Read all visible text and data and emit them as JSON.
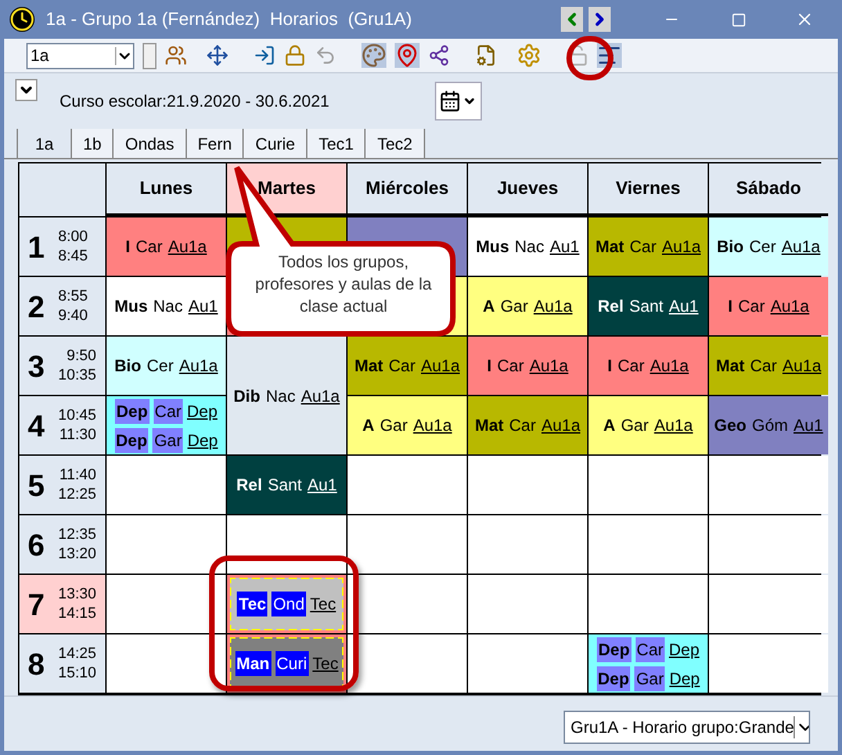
{
  "window": {
    "title": "1a - Grupo 1a (Fernández)  Horarios  (Gru1A)"
  },
  "toolbar": {
    "class_select": {
      "value": "1a"
    }
  },
  "info": {
    "school_year": "Curso escolar:21.9.2020 - 30.6.2021"
  },
  "tabs": [
    {
      "label": "1a",
      "selected": true
    },
    {
      "label": "1b",
      "selected": false
    },
    {
      "label": "Ondas",
      "selected": false
    },
    {
      "label": "Fern",
      "selected": false
    },
    {
      "label": "Curie",
      "selected": false
    },
    {
      "label": "Tec1",
      "selected": false
    },
    {
      "label": "Tec2",
      "selected": false
    }
  ],
  "days": [
    {
      "label": "Lunes",
      "selected": false
    },
    {
      "label": "Martes",
      "selected": true
    },
    {
      "label": "Miércoles",
      "selected": false
    },
    {
      "label": "Jueves",
      "selected": false
    },
    {
      "label": "Viernes",
      "selected": false
    },
    {
      "label": "Sábado",
      "selected": false
    }
  ],
  "periods": [
    {
      "number": "1",
      "start": "8:00",
      "end": "8:45",
      "selected": false,
      "cells": [
        {
          "kind": "lesson",
          "color": "#ff8080",
          "lessons": [
            {
              "kind": "plain",
              "subject": "I",
              "teacher": "Car",
              "room": "Au1a"
            }
          ]
        },
        {
          "kind": "lesson",
          "color": "#b8b800"
        },
        {
          "kind": "lesson",
          "color": "#8080c0"
        },
        {
          "kind": "lesson",
          "color": "#ffffff",
          "lessons": [
            {
              "kind": "plain",
              "subject": "Mus",
              "teacher": "Nac",
              "room": "Au1"
            }
          ]
        },
        {
          "kind": "lesson",
          "color": "#b8b800",
          "lessons": [
            {
              "kind": "plain",
              "subject": "Mat",
              "teacher": "Car",
              "room": "Au1a"
            }
          ]
        },
        {
          "kind": "lesson",
          "color": "#d0ffff",
          "lessons": [
            {
              "kind": "plain",
              "subject": "Bio",
              "teacher": "Cer",
              "room": "Au1a"
            }
          ]
        }
      ]
    },
    {
      "number": "2",
      "start": "8:55",
      "end": "9:40",
      "selected": false,
      "cells": [
        {
          "kind": "lesson",
          "color": "#ffffff",
          "lessons": [
            {
              "kind": "plain",
              "subject": "Mus",
              "teacher": "Nac",
              "room": "Au1"
            }
          ]
        },
        {
          "kind": "lesson",
          "color": "#ff8080"
        },
        {
          "kind": "lesson",
          "color": "#ffff80"
        },
        {
          "kind": "lesson",
          "color": "#ffff80",
          "lessons": [
            {
              "kind": "plain",
              "subject": "A",
              "teacher": "Gar",
              "room": "Au1a"
            }
          ]
        },
        {
          "kind": "lesson",
          "color": "#004040",
          "lessons": [
            {
              "kind": "plain",
              "subject": "Rel",
              "teacher": "Sant",
              "room": "Au1"
            }
          ]
        },
        {
          "kind": "lesson",
          "color": "#ff8080",
          "lessons": [
            {
              "kind": "plain",
              "subject": "I",
              "teacher": "Car",
              "room": "Au1a"
            }
          ]
        }
      ]
    },
    {
      "number": "3",
      "start": "9:50",
      "end": "10:35",
      "selected": false,
      "cells": [
        {
          "kind": "lesson",
          "color": "#d0ffff",
          "lessons": [
            {
              "kind": "plain",
              "subject": "Bio",
              "teacher": "Cer",
              "room": "Au1a"
            }
          ]
        },
        {
          "kind": "lesson",
          "color": "#e0e8f0",
          "lessons": [
            {
              "kind": "plain",
              "subject": "Dib",
              "teacher": "Nac",
              "room": "Au1a"
            }
          ]
        },
        {
          "kind": "lesson",
          "color": "#b8b800",
          "lessons": [
            {
              "kind": "plain",
              "subject": "Mat",
              "teacher": "Car",
              "room": "Au1a"
            }
          ]
        },
        {
          "kind": "lesson",
          "color": "#ff8080",
          "lessons": [
            {
              "kind": "plain",
              "subject": "I",
              "teacher": "Car",
              "room": "Au1a"
            }
          ]
        },
        {
          "kind": "lesson",
          "color": "#ff8080",
          "lessons": [
            {
              "kind": "plain",
              "subject": "I",
              "teacher": "Car",
              "room": "Au1a"
            }
          ]
        },
        {
          "kind": "lesson",
          "color": "#b8b800",
          "lessons": [
            {
              "kind": "plain",
              "subject": "Mat",
              "teacher": "Car",
              "room": "Au1a"
            }
          ]
        }
      ]
    },
    {
      "number": "4",
      "start": "10:45",
      "end": "11:30",
      "selected": false,
      "cells": [
        {
          "kind": "lesson",
          "color": "#80ffff",
          "lessons": [
            {
              "kind": "split",
              "subject": "Dep",
              "teacher": "Car",
              "room": "Dep"
            },
            {
              "kind": "split",
              "subject": "Dep",
              "teacher": "Gar",
              "room": "Dep"
            }
          ]
        },
        {
          "kind": "continued"
        },
        {
          "kind": "lesson",
          "color": "#ffff80",
          "lessons": [
            {
              "kind": "plain",
              "subject": "A",
              "teacher": "Gar",
              "room": "Au1a"
            }
          ]
        },
        {
          "kind": "lesson",
          "color": "#b8b800",
          "lessons": [
            {
              "kind": "plain",
              "subject": "Mat",
              "teacher": "Car",
              "room": "Au1a"
            }
          ]
        },
        {
          "kind": "lesson",
          "color": "#ffff80",
          "lessons": [
            {
              "kind": "plain",
              "subject": "A",
              "teacher": "Gar",
              "room": "Au1a"
            }
          ]
        },
        {
          "kind": "lesson",
          "color": "#8080c0",
          "lessons": [
            {
              "kind": "plain",
              "subject": "Geo",
              "teacher": "Góm",
              "room": "Au1"
            }
          ]
        }
      ]
    },
    {
      "number": "5",
      "start": "11:40",
      "end": "12:25",
      "selected": false,
      "cells": [
        {
          "kind": "empty"
        },
        {
          "kind": "lesson",
          "color": "#004040",
          "lessons": [
            {
              "kind": "plain",
              "subject": "Rel",
              "teacher": "Sant",
              "room": "Au1"
            }
          ]
        },
        {
          "kind": "empty"
        },
        {
          "kind": "empty"
        },
        {
          "kind": "empty"
        },
        {
          "kind": "empty"
        }
      ]
    },
    {
      "number": "6",
      "start": "12:35",
      "end": "13:20",
      "selected": false,
      "cells": [
        {
          "kind": "empty"
        },
        {
          "kind": "empty"
        },
        {
          "kind": "empty"
        },
        {
          "kind": "empty"
        },
        {
          "kind": "empty"
        },
        {
          "kind": "empty"
        }
      ]
    },
    {
      "number": "7",
      "start": "13:30",
      "end": "14:15",
      "selected": true,
      "cells": [
        {
          "kind": "empty"
        },
        {
          "kind": "lesson",
          "color": "#c0c0c0",
          "lessons": [
            {
              "kind": "marked",
              "subject": "Tec",
              "teacher": "Ond",
              "room": "Tec"
            }
          ]
        },
        {
          "kind": "empty"
        },
        {
          "kind": "empty"
        },
        {
          "kind": "empty"
        },
        {
          "kind": "empty"
        }
      ]
    },
    {
      "number": "8",
      "start": "14:25",
      "end": "15:10",
      "selected": false,
      "cells": [
        {
          "kind": "empty"
        },
        {
          "kind": "lesson",
          "color": "#808080",
          "lessons": [
            {
              "kind": "marked",
              "subject": "Man",
              "teacher": "Curi",
              "room": "Tec"
            }
          ]
        },
        {
          "kind": "empty"
        },
        {
          "kind": "empty"
        },
        {
          "kind": "lesson",
          "color": "#80ffff",
          "lessons": [
            {
              "kind": "split",
              "subject": "Dep",
              "teacher": "Car",
              "room": "Dep"
            },
            {
              "kind": "split",
              "subject": "Dep",
              "teacher": "Gar",
              "room": "Dep"
            }
          ]
        },
        {
          "kind": "empty"
        }
      ]
    }
  ],
  "callout": {
    "text": "Todos los grupos, profesores y aulas de la clase actual"
  },
  "status_bar": {
    "view_select": {
      "value": "Gru1A - Horario grupo:Grande"
    }
  }
}
